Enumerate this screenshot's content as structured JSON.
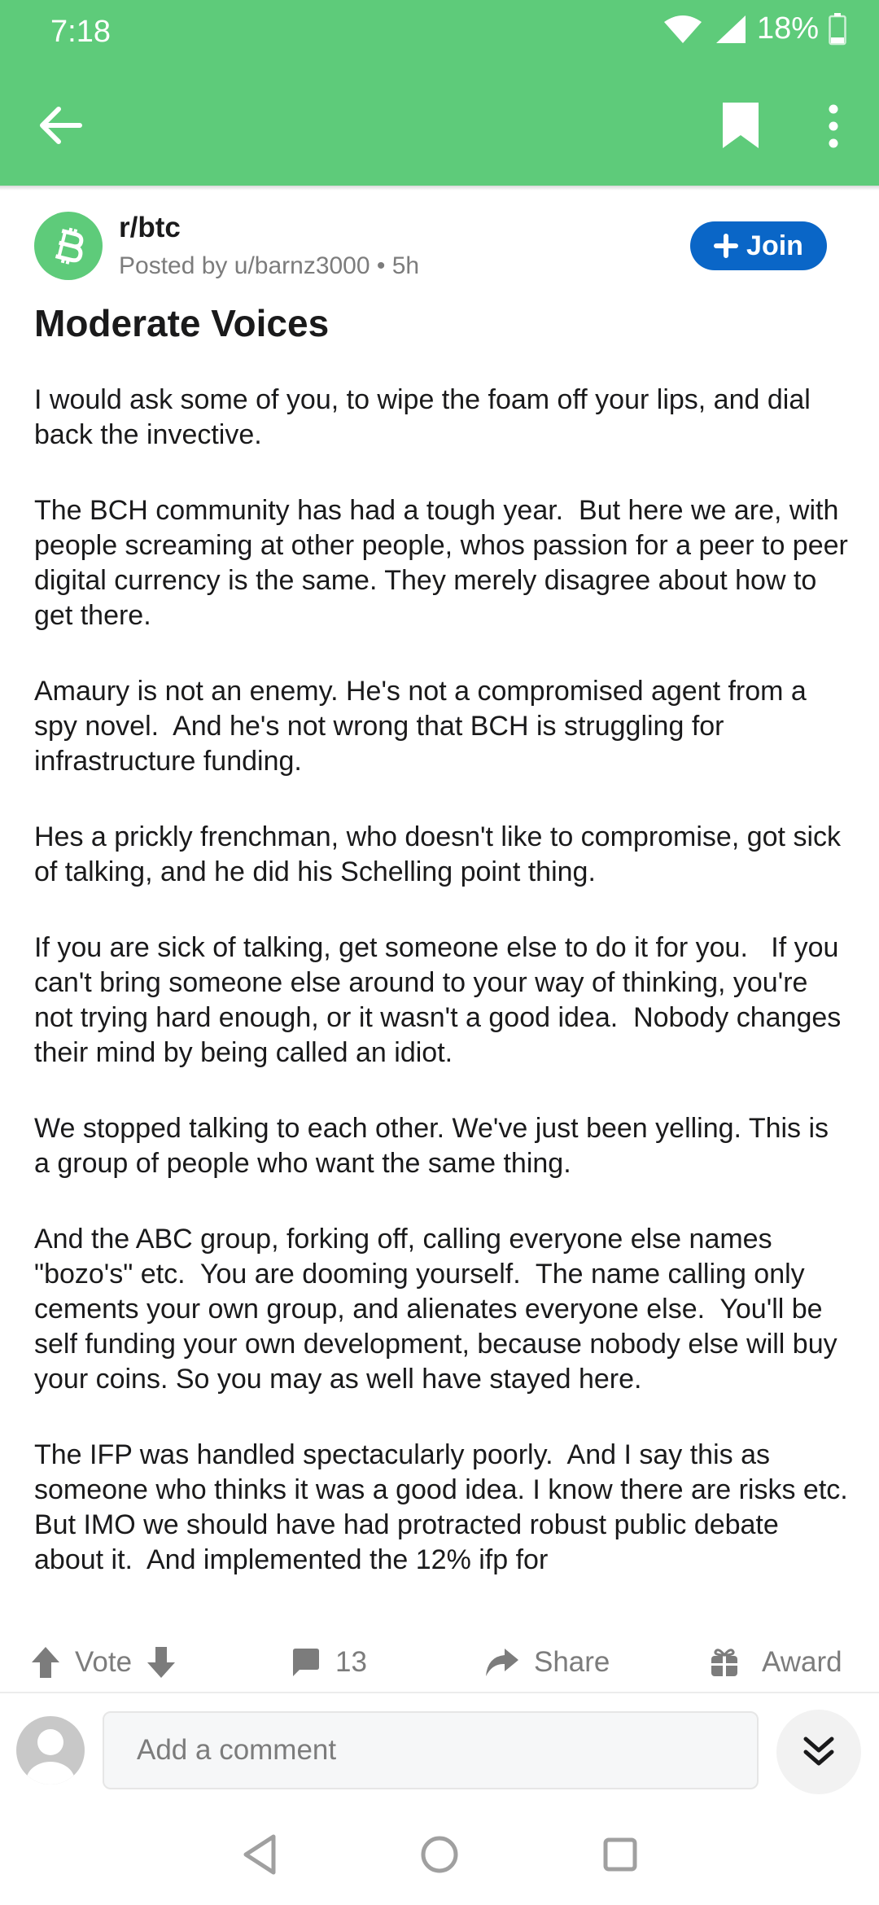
{
  "status": {
    "time": "7:18",
    "battery": "18%"
  },
  "post": {
    "subreddit": "r/btc",
    "meta": "Posted by u/barnz3000 • 5h",
    "join_label": "Join",
    "title": "Moderate Voices",
    "paragraphs": [
      "I would ask some of you, to wipe the foam off your lips, and dial back the invective.",
      "The BCH community has had a tough year.  But here we are, with people screaming at other people, whos passion for a peer to peer digital currency is the same. They merely disagree about how to get there.",
      "Amaury is not an enemy. He's not a compromised agent from a spy novel.  And he's not wrong that BCH is struggling for infrastructure funding.",
      "Hes a prickly frenchman, who doesn't like to compromise, got sick of talking, and he did his Schelling point thing.",
      "If you are sick of talking, get someone else to do it for you.   If you can't bring someone else around to your way of thinking, you're not trying hard enough, or it wasn't a good idea.  Nobody changes their mind by being called an idiot.",
      "We stopped talking to each other. We've just been yelling. This is a group of people who want the same thing.",
      "And the ABC group, forking off, calling everyone else names \"bozo's\" etc.  You are dooming yourself.  The name calling only cements your own group, and alienates everyone else.  You'll be self funding your own development, because nobody else will buy your coins. So you may as well have stayed here.",
      "The IFP was handled spectacularly poorly.  And I say this as someone who thinks it was a good idea. I know there are risks etc. But IMO we should have had protracted robust public debate about it.  And implemented the 12% ifp for"
    ]
  },
  "actions": {
    "vote_label": "Vote",
    "comments_count": "13",
    "share_label": "Share",
    "award_label": "Award"
  },
  "composer": {
    "placeholder": "Add a comment"
  },
  "colors": {
    "header_green": "#5ecb7a",
    "join_blue": "#0a66c7",
    "muted": "#7c7c7c"
  },
  "icons": {
    "appbar": [
      "back-arrow-icon",
      "bookmark-icon",
      "more-vert-icon"
    ],
    "actions": [
      "upvote-icon",
      "downvote-icon",
      "comment-icon",
      "share-icon",
      "award-icon"
    ],
    "nav": [
      "nav-back-icon",
      "nav-home-icon",
      "nav-recents-icon"
    ]
  }
}
